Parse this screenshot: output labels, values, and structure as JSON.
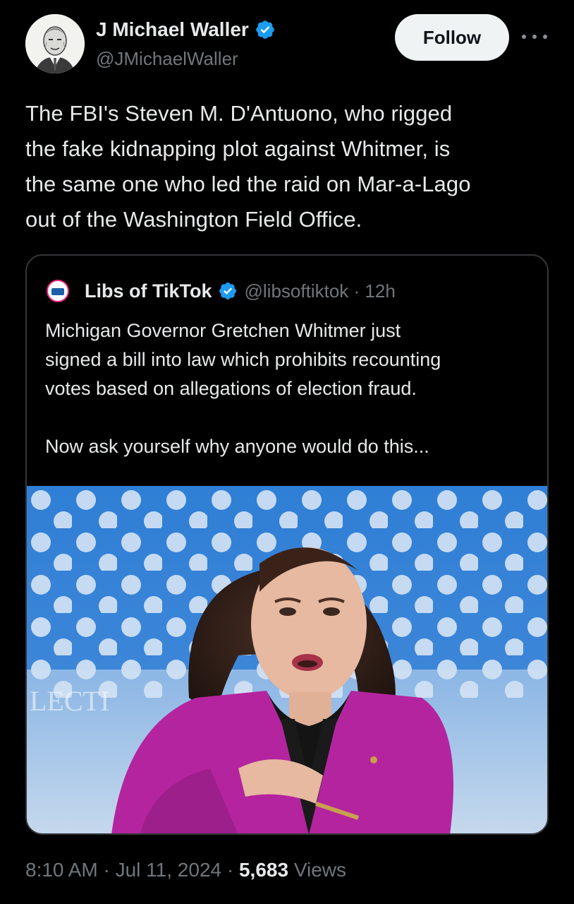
{
  "author": {
    "display_name": "J Michael Waller",
    "handle": "@JMichaelWaller",
    "verified": true,
    "avatar_icon": "avatar-portrait"
  },
  "follow_label": "Follow",
  "more_icon": "ellipsis-icon",
  "tweet": {
    "lines": [
      "The FBI's Steven M. D'Antuono, who rigged",
      "the fake kidnapping plot against Whitmer, is",
      "the same one who led the raid on Mar-a-Lago",
      "out of the Washington Field Office."
    ]
  },
  "quote": {
    "display_name": "Libs of TikTok",
    "handle_time": "@libsoftiktok · 12h",
    "verified": true,
    "avatar_text": "Libs of TikTok",
    "lines_1": [
      "Michigan Governor Gretchen Whitmer just",
      "signed a bill into law which prohibits recounting",
      "votes based on allegations of election fraud."
    ],
    "line_2": "Now ask yourself why anyone would do this...",
    "image_text": "LECTI"
  },
  "meta": {
    "time_date": "8:10 AM · Jul 11, 2024 · ",
    "views_count": "5,683",
    "views_label": " Views"
  },
  "colors": {
    "background": "#000000",
    "text": "#e7e9ea",
    "muted": "#71767b",
    "verified_blue": "#1d9bf0",
    "follow_bg": "#eff3f4",
    "border": "#333639",
    "jacket": "#b5249f"
  }
}
